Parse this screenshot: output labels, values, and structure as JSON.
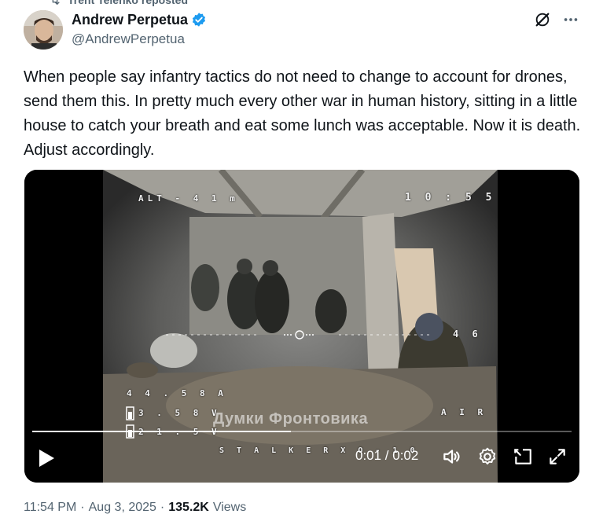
{
  "repost": {
    "label": "Trent Telenko reposted"
  },
  "author": {
    "display_name": "Andrew Perpetua",
    "handle": "@AndrewPerpetua",
    "verified": true,
    "verified_color": "#1d9bf0"
  },
  "tweet": {
    "text": "When people say infantry tactics do not need to change to account for drones, send them this. In pretty much every other war in human history, sitting in a little house to catch your breath and eat some lunch was acceptable. Now it is death. Adjust accordingly."
  },
  "video": {
    "hud": {
      "altitude": "ALT - 4 1 m",
      "clock": "1 0 : 5 5",
      "speed": "4 6",
      "voltage_1": "4 4 . 5 8 A",
      "voltage_2": "3 . 5 8 V",
      "voltage_3": "2 1 . 5 V",
      "mode": "A I R",
      "callsign": "S T A L K E R   X O - 1 0"
    },
    "watermark": "Думки Фронтовика",
    "current_time": "0:01",
    "duration": "0:02",
    "time_display": "0:01 / 0:02",
    "progress_fraction": 0.48
  },
  "meta": {
    "time": "11:54 PM",
    "separator": "·",
    "date": "Aug 3, 2025",
    "views_count": "135.2K",
    "views_label": "Views"
  },
  "icons": {
    "repost": "repost-icon",
    "verified": "verified-badge-icon",
    "grok": "grok-icon",
    "more": "more-icon",
    "play": "play-icon",
    "volume": "volume-icon",
    "settings": "settings-icon",
    "pip": "pip-icon",
    "fullscreen": "fullscreen-icon"
  }
}
